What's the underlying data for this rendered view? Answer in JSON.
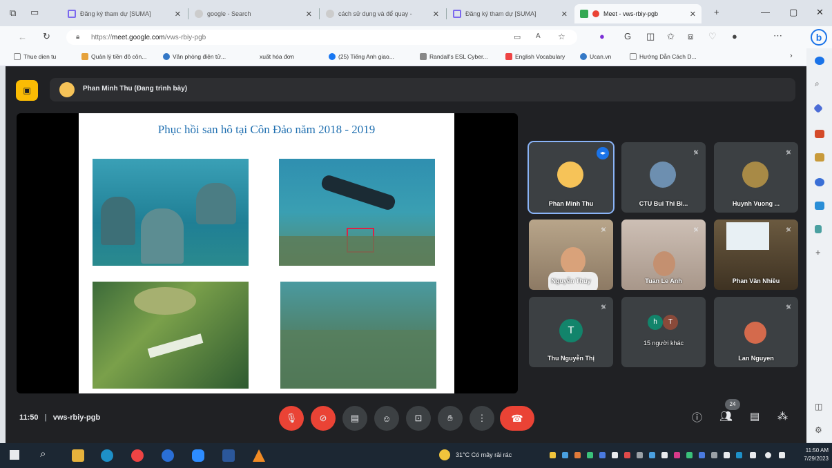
{
  "browser": {
    "tabs": [
      {
        "title": "Đăng ký tham dự [SUMA]",
        "fav": "#7b68ee"
      },
      {
        "title": "google - Search",
        "fav": "#cccccc"
      },
      {
        "title": "cách sử dụng và để quay -",
        "fav": "#cccccc"
      },
      {
        "title": "Đăng ký tham dự [SUMA]",
        "fav": "#7b68ee"
      },
      {
        "title": "Meet - vws-rbiy-pgb",
        "fav": "#34a853"
      }
    ],
    "new_tab": "+",
    "url_prefix": "https://",
    "url_host": "meet.google.com",
    "url_path": "/vws-rbiy-pgb",
    "bookmarks": [
      {
        "label": "Thue dien tu",
        "color": "#888888"
      },
      {
        "label": "Quản lý tiền đô côn...",
        "color": "#e6a23c"
      },
      {
        "label": "Văn phòng điện tử...",
        "color": "#3478c6"
      },
      {
        "label": "xuất hóa đơn",
        "color": "#888888"
      },
      {
        "label": "(25) Tiếng Anh giao...",
        "color": "#1877f2"
      },
      {
        "label": "Randall's ESL Cyber...",
        "color": "#888888"
      },
      {
        "label": "English Vocabulary",
        "color": "#e44"
      },
      {
        "label": "Ucan.vn",
        "color": "#3478c6"
      },
      {
        "label": "Hướng Dẫn Cách D...",
        "color": "#888888"
      }
    ]
  },
  "meet": {
    "presenter_label": "Phan Minh Thu (Đang trình bày)",
    "slide_title": "Phục hồi san hô tại Côn Đảo năm 2018 - 2019",
    "tiles": [
      {
        "name": "Phan Minh Thu",
        "type": "avatar",
        "color": "#f6c358",
        "speaking": true
      },
      {
        "name": "CTU Bui Thi Bi...",
        "type": "avatar",
        "color": "#6d8fb0",
        "speaking": false
      },
      {
        "name": "Huynh Vuong ...",
        "type": "avatar",
        "color": "#a88a46",
        "speaking": false
      },
      {
        "name": "Nguyễn Thùy",
        "type": "video",
        "color": "#8d7a64",
        "speaking": false
      },
      {
        "name": "Tuan Le Anh",
        "type": "video",
        "color": "#b9a89a",
        "speaking": false
      },
      {
        "name": "Phan Văn Nhiều",
        "type": "video",
        "color": "#5a4a36",
        "speaking": false
      },
      {
        "name": "Thu Nguyễn Thị",
        "type": "letter",
        "letter": "T",
        "color": "#12846b",
        "speaking": false
      },
      {
        "name": "15 người khác",
        "type": "group",
        "letters": [
          "h",
          "T"
        ],
        "color": "#12846b",
        "speaking": false
      },
      {
        "name": "Lan Nguyen",
        "type": "avatar",
        "color": "#d46a4c",
        "speaking": false
      }
    ],
    "time": "11:50",
    "separator": "|",
    "meeting_code": "vws-rbiy-pgb",
    "people_count": "24"
  },
  "taskbar": {
    "weather": "31°C  Có mây rải rác",
    "time": "11:50 AM",
    "date": "7/29/2023"
  }
}
